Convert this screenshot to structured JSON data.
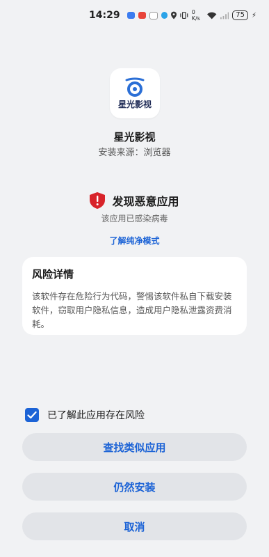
{
  "status_bar": {
    "time": "14:29",
    "battery": "75",
    "icons": [
      "location-icon",
      "vibrate-icon",
      "network-speed-icon",
      "wifi-icon",
      "signal-icon",
      "battery-icon",
      "charging-icon"
    ],
    "network_speed": "0 K/s"
  },
  "app": {
    "name": "星光影视",
    "icon_text": "星光影视",
    "source": "安装来源：浏览器",
    "brand_color": "#1e2a55"
  },
  "warning": {
    "title": "发现恶意应用",
    "subtitle": "该应用已感染病毒",
    "link": "了解纯净模式",
    "shield_color": "#d8232a"
  },
  "risk": {
    "title": "风险详情",
    "description": "该软件存在危险行为代码，警惕该软件私自下载安装软件，窃取用户隐私信息，造成用户隐私泄露资费消耗。"
  },
  "acknowledge": {
    "label": "已了解此应用存在风险",
    "checked": true
  },
  "buttons": {
    "find_similar": "查找类似应用",
    "install_anyway": "仍然安装",
    "cancel": "取消"
  },
  "accent_color": "#1c63d6"
}
